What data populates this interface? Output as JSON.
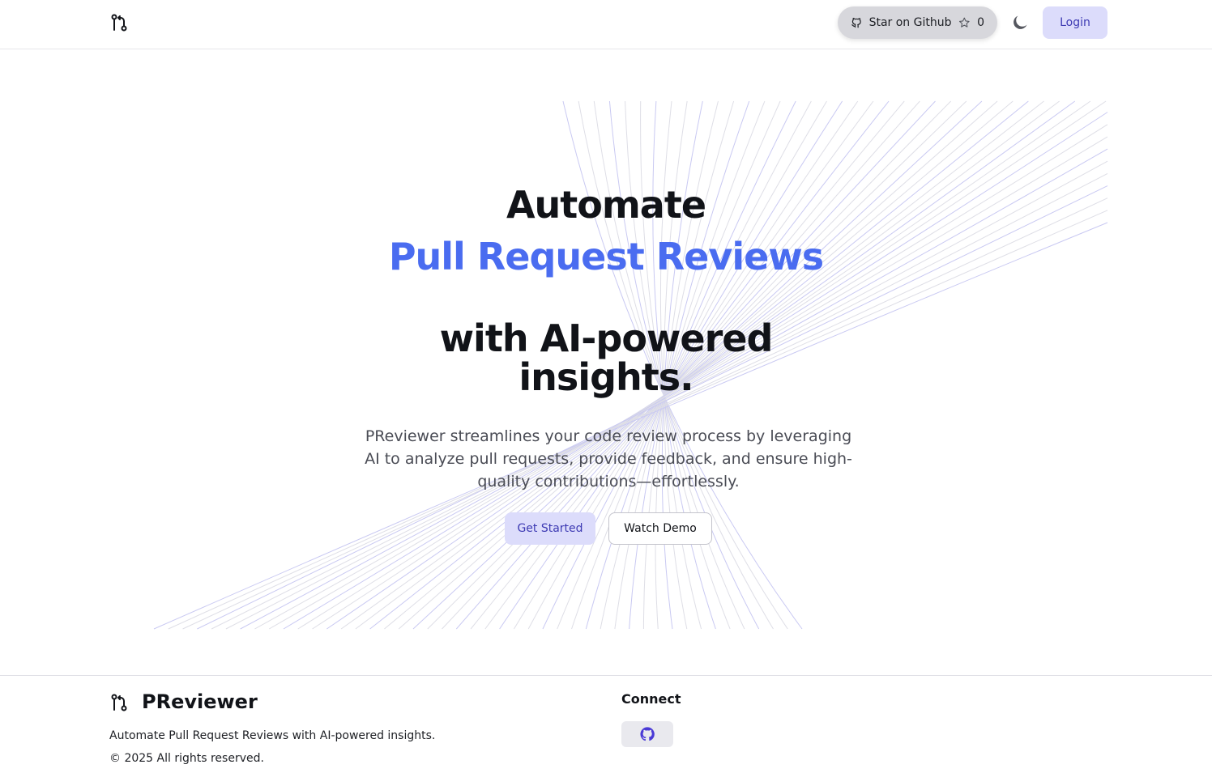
{
  "header": {
    "logo_icon": "git-pull-request-icon",
    "github_button": {
      "label": "Star on Github",
      "star_count": "0",
      "github_icon": "github-icon",
      "star_icon": "star-icon"
    },
    "theme_toggle_icon": "moon-icon",
    "login_label": "Login"
  },
  "hero": {
    "line1": "Automate",
    "line2": "Pull Request Reviews",
    "line3": "with AI-powered",
    "line4": "insights.",
    "subtitle": "PReviewer streamlines your code review process by leveraging AI to analyze pull requests, provide feedback, and ensure high-quality contributions—effortlessly.",
    "get_started_label": "Get Started",
    "watch_demo_label": "Watch Demo"
  },
  "footer": {
    "brand": "PReviewer",
    "tagline": "Automate Pull Request Reviews with AI-powered insights.",
    "copyright": "© 2025 All rights reserved.",
    "connect_title": "Connect",
    "connect_github_icon": "github-icon"
  },
  "colors": {
    "accent": "#4a6cf0",
    "button_bg": "#dcdcfb",
    "button_text": "#3d3ab3",
    "text": "#111318",
    "muted": "#4a4c55"
  }
}
